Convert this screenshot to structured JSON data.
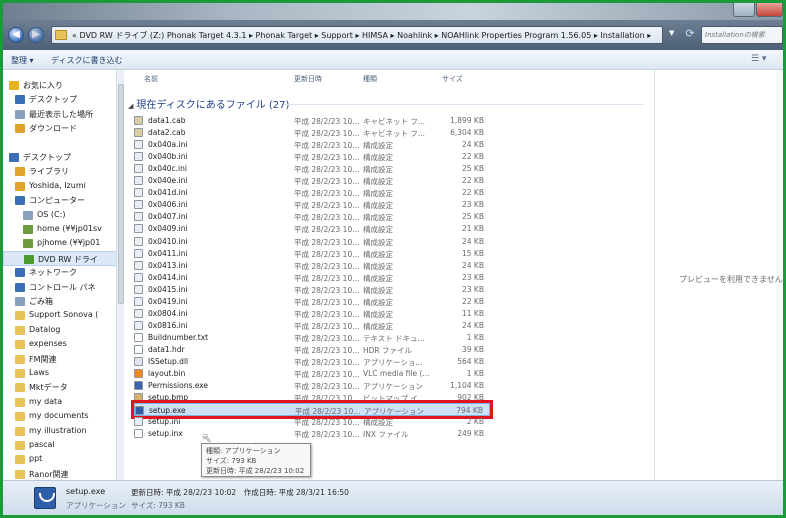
{
  "window": {
    "search_placeholder": "Installationの検索"
  },
  "address": {
    "path": "« DVD RW ドライブ (Z:) Phonak Target 4.3.1 ▸ Phonak Target ▸ Support ▸ HIMSA ▸ Noahlink ▸ NOAHlink Properties Program 1.56.05 ▸ Installation ▸"
  },
  "toolbar": {
    "organize": "整理 ▾",
    "burn": "ディスクに書き込む"
  },
  "nav_items": [
    {
      "label": "お気に入り",
      "icon": "star-icon",
      "color": "#e5b421",
      "indent": 6
    },
    {
      "label": "デスクトップ",
      "icon": "desktop-icon",
      "color": "#3a6fb7",
      "indent": 12
    },
    {
      "label": "最近表示した場所",
      "icon": "recent-places-icon",
      "color": "#8aa1bd",
      "indent": 12
    },
    {
      "label": "ダウンロード",
      "icon": "download-icon",
      "color": "#e0a42c",
      "indent": 12
    },
    {
      "label": "",
      "icon": "",
      "color": "",
      "indent": 0
    },
    {
      "label": "デスクトップ",
      "icon": "desktop-icon",
      "color": "#3a6fb7",
      "indent": 6
    },
    {
      "label": "ライブラリ",
      "icon": "library-icon",
      "color": "#e0a42c",
      "indent": 12
    },
    {
      "label": "Yoshida, Izumi",
      "icon": "user-folder-icon",
      "color": "#e0a42c",
      "indent": 12
    },
    {
      "label": "コンピューター",
      "icon": "computer-icon",
      "color": "#3a6fb7",
      "indent": 12
    },
    {
      "label": "OS (C:)",
      "icon": "drive-icon",
      "color": "#8aa1bd",
      "indent": 20
    },
    {
      "label": "home (¥¥jp01sv",
      "icon": "network-drive-icon",
      "color": "#6c9a3c",
      "indent": 20
    },
    {
      "label": "pjhome (¥¥jp01",
      "icon": "network-drive-icon",
      "color": "#6c9a3c",
      "indent": 20
    },
    {
      "label": "DVD RW ドライ",
      "icon": "dvd-drive-icon",
      "color": "#4a9a2e",
      "indent": 20,
      "selected": true
    },
    {
      "label": "ネットワーク",
      "icon": "network-icon",
      "color": "#3a6fb7",
      "indent": 12
    },
    {
      "label": "コントロール パネ",
      "icon": "control-panel-icon",
      "color": "#3a6fb7",
      "indent": 12
    },
    {
      "label": "ごみ箱",
      "icon": "recycle-bin-icon",
      "color": "#8aa1bd",
      "indent": 12
    },
    {
      "label": "Support Sonova (",
      "icon": "folder-icon",
      "color": "#e7c35a",
      "indent": 12
    },
    {
      "label": "Datalog",
      "icon": "folder-icon",
      "color": "#e7c35a",
      "indent": 12
    },
    {
      "label": "expenses",
      "icon": "folder-icon",
      "color": "#e7c35a",
      "indent": 12
    },
    {
      "label": "FM関連",
      "icon": "folder-icon",
      "color": "#e7c35a",
      "indent": 12
    },
    {
      "label": "Laws",
      "icon": "folder-icon",
      "color": "#e7c35a",
      "indent": 12
    },
    {
      "label": "Mktデータ",
      "icon": "folder-icon",
      "color": "#e7c35a",
      "indent": 12
    },
    {
      "label": "my data",
      "icon": "folder-icon",
      "color": "#e7c35a",
      "indent": 12
    },
    {
      "label": "my documents",
      "icon": "folder-icon",
      "color": "#e7c35a",
      "indent": 12
    },
    {
      "label": "my illustration",
      "icon": "folder-icon",
      "color": "#e7c35a",
      "indent": 12
    },
    {
      "label": "pascal",
      "icon": "folder-icon",
      "color": "#e7c35a",
      "indent": 12
    },
    {
      "label": "ppt",
      "icon": "folder-icon",
      "color": "#e7c35a",
      "indent": 12
    },
    {
      "label": "Ranor関連",
      "icon": "folder-icon",
      "color": "#e7c35a",
      "indent": 12
    }
  ],
  "columns": {
    "name": "名前",
    "date": "更新日時",
    "type": "種類",
    "size": "サイズ"
  },
  "group_header": "現在ディスクにあるファイル (27)",
  "files": [
    {
      "name": "data1.cab",
      "date": "平成 28/2/23 10...",
      "type": "キャビネット フ...",
      "size": "1,899 KB",
      "icon": "cab-file-icon"
    },
    {
      "name": "data2.cab",
      "date": "平成 28/2/23 10...",
      "type": "キャビネット フ...",
      "size": "6,304 KB",
      "icon": "cab-file-icon"
    },
    {
      "name": "0x040a.ini",
      "date": "平成 28/2/23 10...",
      "type": "構成設定",
      "size": "24 KB",
      "icon": "ini-file-icon"
    },
    {
      "name": "0x040b.ini",
      "date": "平成 28/2/23 10...",
      "type": "構成設定",
      "size": "22 KB",
      "icon": "ini-file-icon"
    },
    {
      "name": "0x040c.ini",
      "date": "平成 28/2/23 10...",
      "type": "構成設定",
      "size": "25 KB",
      "icon": "ini-file-icon"
    },
    {
      "name": "0x040e.ini",
      "date": "平成 28/2/23 10...",
      "type": "構成設定",
      "size": "22 KB",
      "icon": "ini-file-icon"
    },
    {
      "name": "0x041d.ini",
      "date": "平成 28/2/23 10...",
      "type": "構成設定",
      "size": "22 KB",
      "icon": "ini-file-icon"
    },
    {
      "name": "0x0406.ini",
      "date": "平成 28/2/23 10...",
      "type": "構成設定",
      "size": "23 KB",
      "icon": "ini-file-icon"
    },
    {
      "name": "0x0407.ini",
      "date": "平成 28/2/23 10...",
      "type": "構成設定",
      "size": "25 KB",
      "icon": "ini-file-icon"
    },
    {
      "name": "0x0409.ini",
      "date": "平成 28/2/23 10...",
      "type": "構成設定",
      "size": "21 KB",
      "icon": "ini-file-icon"
    },
    {
      "name": "0x0410.ini",
      "date": "平成 28/2/23 10...",
      "type": "構成設定",
      "size": "24 KB",
      "icon": "ini-file-icon"
    },
    {
      "name": "0x0411.ini",
      "date": "平成 28/2/23 10...",
      "type": "構成設定",
      "size": "15 KB",
      "icon": "ini-file-icon"
    },
    {
      "name": "0x0413.ini",
      "date": "平成 28/2/23 10...",
      "type": "構成設定",
      "size": "24 KB",
      "icon": "ini-file-icon"
    },
    {
      "name": "0x0414.ini",
      "date": "平成 28/2/23 10...",
      "type": "構成設定",
      "size": "23 KB",
      "icon": "ini-file-icon"
    },
    {
      "name": "0x0415.ini",
      "date": "平成 28/2/23 10...",
      "type": "構成設定",
      "size": "23 KB",
      "icon": "ini-file-icon"
    },
    {
      "name": "0x0419.ini",
      "date": "平成 28/2/23 10...",
      "type": "構成設定",
      "size": "22 KB",
      "icon": "ini-file-icon"
    },
    {
      "name": "0x0804.ini",
      "date": "平成 28/2/23 10...",
      "type": "構成設定",
      "size": "11 KB",
      "icon": "ini-file-icon"
    },
    {
      "name": "0x0816.ini",
      "date": "平成 28/2/23 10...",
      "type": "構成設定",
      "size": "24 KB",
      "icon": "ini-file-icon"
    },
    {
      "name": "Buildnumber.txt",
      "date": "平成 28/2/23 10...",
      "type": "テキスト ドキュ...",
      "size": "1 KB",
      "icon": "text-file-icon"
    },
    {
      "name": "data1.hdr",
      "date": "平成 28/2/23 10...",
      "type": "HDR ファイル",
      "size": "39 KB",
      "icon": "file-icon"
    },
    {
      "name": "ISSetup.dll",
      "date": "平成 28/2/23 10...",
      "type": "アプリケーショ...",
      "size": "564 KB",
      "icon": "dll-file-icon"
    },
    {
      "name": "layout.bin",
      "date": "平成 28/2/23 10...",
      "type": "VLC media file (...",
      "size": "1 KB",
      "icon": "vlc-file-icon"
    },
    {
      "name": "Permissions.exe",
      "date": "平成 28/2/23 10...",
      "type": "アプリケーション",
      "size": "1,104 KB",
      "icon": "exe-file-icon"
    },
    {
      "name": "setup.bmp",
      "date": "平成 28/2/23 10...",
      "type": "ビットマップ イ...",
      "size": "902 KB",
      "icon": "bitmap-file-icon"
    },
    {
      "name": "setup.exe",
      "date": "平成 28/2/23 10...",
      "type": "アプリケーション",
      "size": "794 KB",
      "icon": "setup-exe-icon",
      "highlighted": true
    },
    {
      "name": "setup.ini",
      "date": "平成 28/2/23 10...",
      "type": "構成設定",
      "size": "2 KB",
      "icon": "ini-file-icon"
    },
    {
      "name": "setup.inx",
      "date": "平成 28/2/23 10...",
      "type": "INX ファイル",
      "size": "249 KB",
      "icon": "file-icon"
    }
  ],
  "tooltip": {
    "type_line": "種類: アプリケーション",
    "size_line": "サイズ: 793 KB",
    "date_line": "更新日時: 平成 28/2/23 10:02"
  },
  "preview_text": "プレビューを利用できません。",
  "details": {
    "name": "setup.exe",
    "type": "アプリケーション",
    "meta": "更新日時: 平成 28/2/23 10:02　作成日時: 平成 28/3/21 16:50",
    "size": "サイズ: 793 KB"
  },
  "colors": {
    "frame_green": "#1b9a3a",
    "highlight_red": "#e0141e",
    "selection_blue": "#cde2f8"
  }
}
